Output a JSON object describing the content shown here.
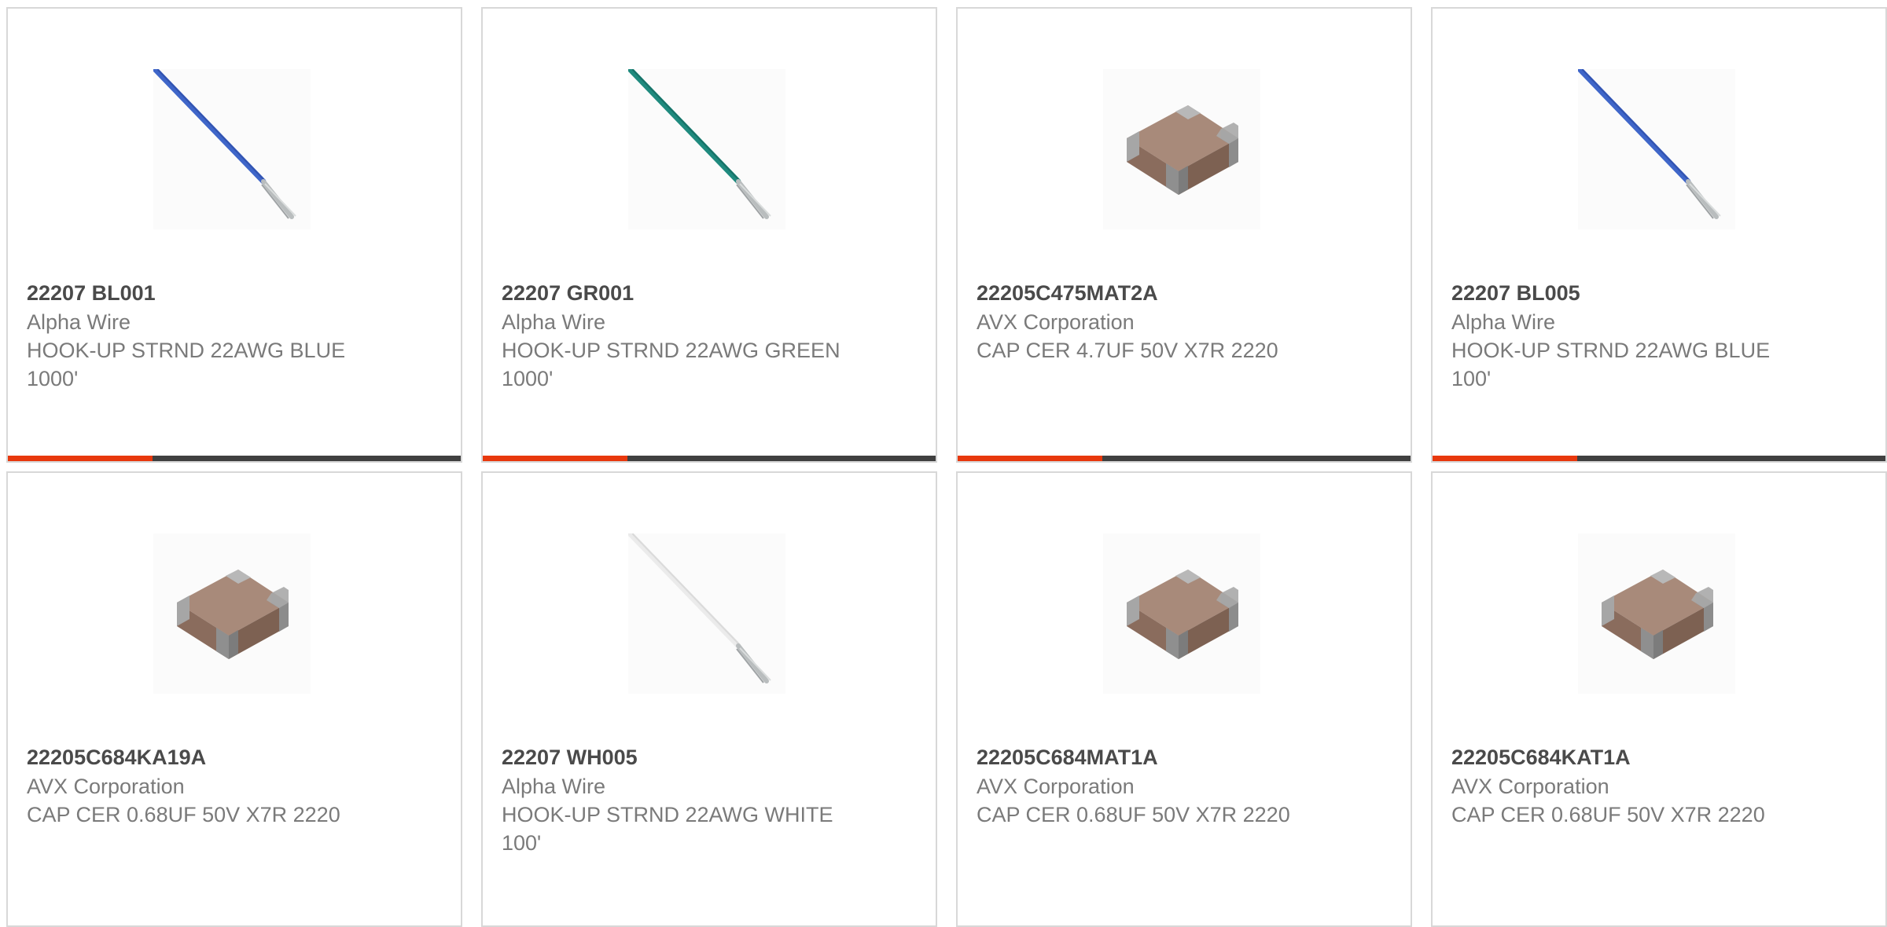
{
  "colors": {
    "accent": "#e8380d",
    "bar_track": "#404040",
    "border": "#d8d8d8",
    "text": "#7a7a7a"
  },
  "products": [
    {
      "part_number": "22207 BL001",
      "manufacturer": "Alpha Wire",
      "description": "HOOK-UP STRND 22AWG BLUE 1000'",
      "image": "blue-wire-icon",
      "progress": 0.32,
      "show_bar": true
    },
    {
      "part_number": "22207 GR001",
      "manufacturer": "Alpha Wire",
      "description": "HOOK-UP STRND 22AWG GREEN 1000'",
      "image": "green-wire-icon",
      "progress": 0.32,
      "show_bar": true
    },
    {
      "part_number": "22205C475MAT2A",
      "manufacturer": "AVX Corporation",
      "description": "CAP CER 4.7UF 50V X7R 2220",
      "image": "ceramic-capacitor-icon",
      "progress": 0.32,
      "show_bar": true
    },
    {
      "part_number": "22207 BL005",
      "manufacturer": "Alpha Wire",
      "description": "HOOK-UP STRND 22AWG BLUE 100'",
      "image": "blue-wire-icon",
      "progress": 0.32,
      "show_bar": true
    },
    {
      "part_number": "22205C684KA19A",
      "manufacturer": "AVX Corporation",
      "description": "CAP CER 0.68UF 50V X7R 2220",
      "image": "ceramic-capacitor-icon",
      "progress": 0,
      "show_bar": false
    },
    {
      "part_number": "22207 WH005",
      "manufacturer": "Alpha Wire",
      "description": "HOOK-UP STRND 22AWG WHITE 100'",
      "image": "white-wire-icon",
      "progress": 0,
      "show_bar": false
    },
    {
      "part_number": "22205C684MAT1A",
      "manufacturer": "AVX Corporation",
      "description": "CAP CER 0.68UF 50V X7R 2220",
      "image": "ceramic-capacitor-icon",
      "progress": 0,
      "show_bar": false
    },
    {
      "part_number": "22205C684KAT1A",
      "manufacturer": "AVX Corporation",
      "description": "CAP CER 0.68UF 50V X7R 2220",
      "image": "ceramic-capacitor-icon",
      "progress": 0,
      "show_bar": false
    }
  ]
}
